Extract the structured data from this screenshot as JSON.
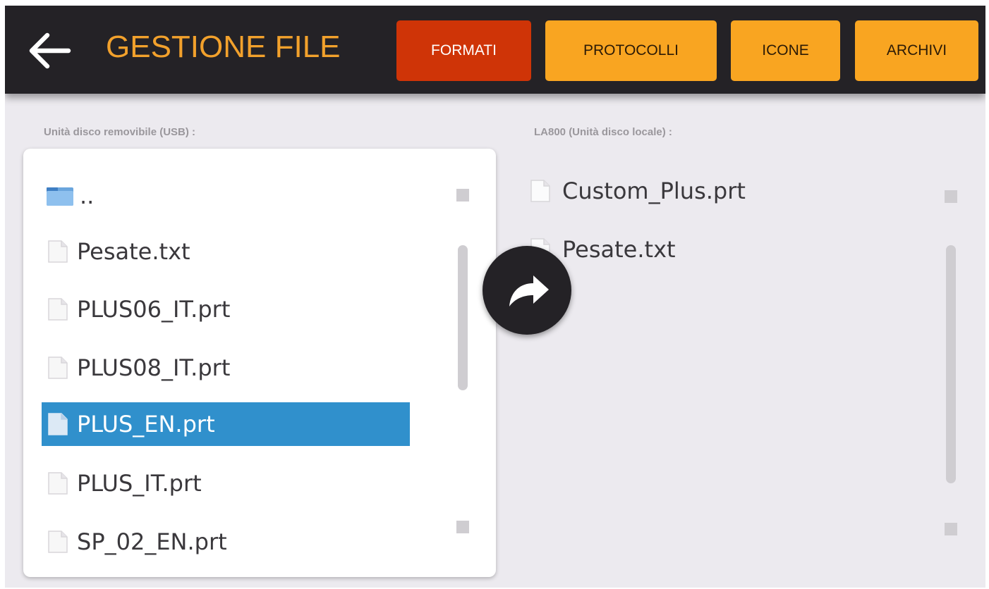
{
  "header": {
    "title": "GESTIONE FILE",
    "tabs": [
      {
        "label": "FORMATI",
        "active": true
      },
      {
        "label": "PROTOCOLLI",
        "active": false
      },
      {
        "label": "ICONE",
        "active": false
      },
      {
        "label": "ARCHIVI",
        "active": false
      }
    ]
  },
  "left_pane": {
    "label": "Unità disco removibile (USB) :",
    "items": [
      {
        "name": "..",
        "type": "folder"
      },
      {
        "name": "Pesate.txt",
        "type": "file"
      },
      {
        "name": "PLUS06_IT.prt",
        "type": "file"
      },
      {
        "name": "PLUS08_IT.prt",
        "type": "file"
      },
      {
        "name": "PLUS_EN.prt",
        "type": "file",
        "selected": true
      },
      {
        "name": "PLUS_IT.prt",
        "type": "file"
      },
      {
        "name": "SP_02_EN.prt",
        "type": "file"
      }
    ]
  },
  "right_pane": {
    "label": "LA800 (Unità disco locale) :",
    "items": [
      {
        "name": "Custom_Plus.prt",
        "type": "file"
      },
      {
        "name": "Pesate.txt",
        "type": "file"
      }
    ]
  },
  "icons": {
    "back": "arrow-left-icon",
    "copy": "share-arrow-icon",
    "folder": "folder-icon",
    "file": "file-icon"
  },
  "colors": {
    "header_bg": "#242226",
    "title": "#f2a12c",
    "tab_active": "#cf3407",
    "tab_inactive": "#f9a521",
    "selection": "#3090cc",
    "background": "#eceaef"
  }
}
